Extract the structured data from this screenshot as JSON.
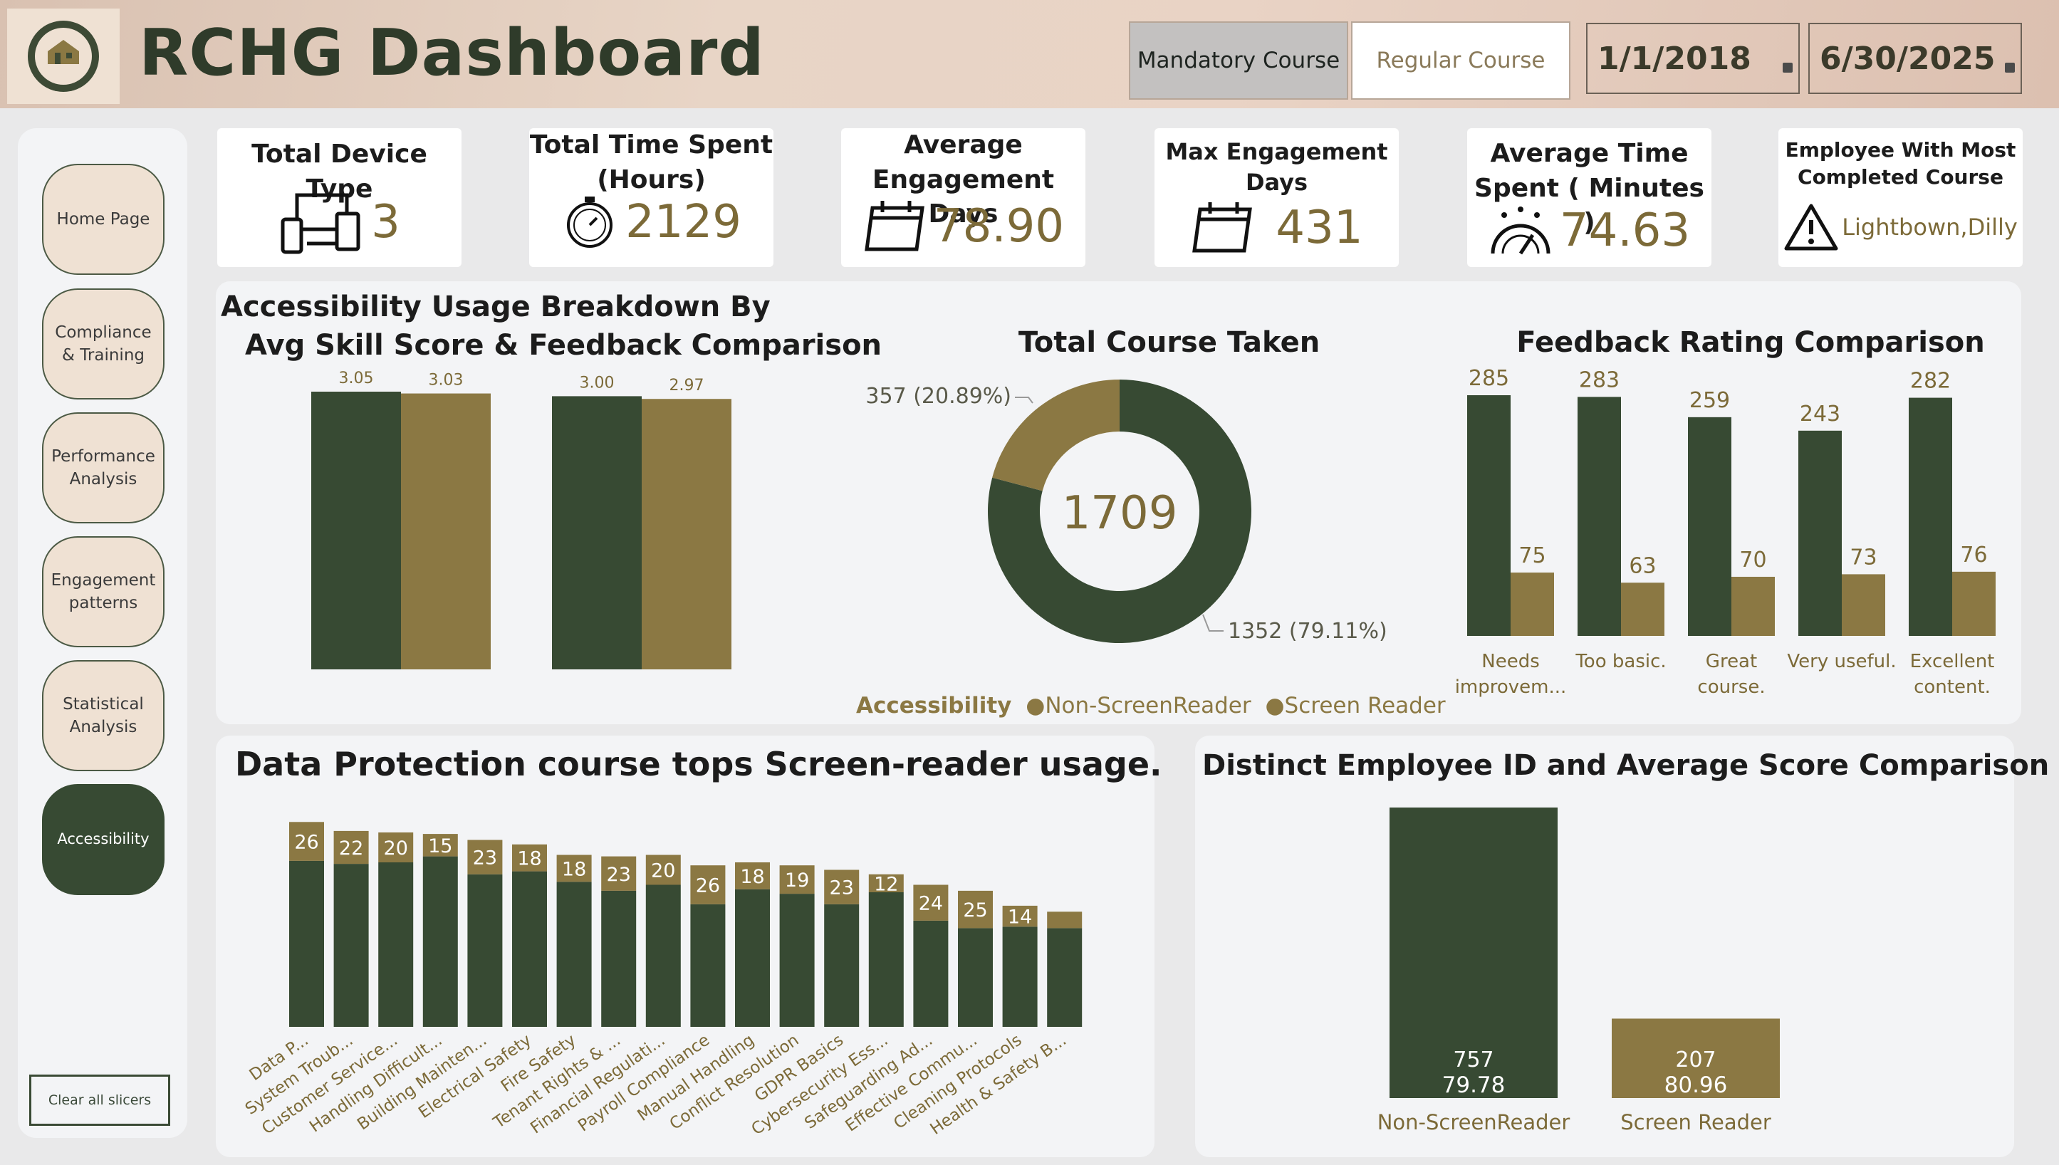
{
  "header": {
    "title": "RCHG Dashboard",
    "course_buttons": [
      "Mandatory Course",
      "Regular Course"
    ],
    "start_date": "1/1/2018",
    "end_date": "6/30/2025"
  },
  "sidebar": {
    "items": [
      "Home Page",
      "Compliance & Training",
      "Performance Analysis",
      "Engagement patterns",
      "Statistical Analysis",
      "Accessibility"
    ],
    "active": "Accessibility",
    "clear_label": "Clear all slicers"
  },
  "kpis": {
    "device": {
      "title": "Total Device Type",
      "value": "3",
      "icon": "devices-icon"
    },
    "time": {
      "title": "Total Time Spent (Hours)",
      "value": "2129",
      "icon": "stopwatch-icon"
    },
    "avg_eng": {
      "title": "Average Engagement Days",
      "value": "78.90",
      "icon": "calendar-icon"
    },
    "max_eng": {
      "title": "Max Engagement Days",
      "value": "431",
      "icon": "calendar-icon"
    },
    "avg_time": {
      "title": "Average Time Spent ( Minutes )",
      "value": "74.63",
      "icon": "speedometer-icon"
    },
    "top_emp": {
      "title": "Employee With Most Completed Course",
      "value": "Lightbown,Dilly",
      "icon": "warning-icon"
    }
  },
  "colors": {
    "dark": "#374a33",
    "gold": "#8b7843",
    "label": "#7c6a38"
  },
  "chart_data": [
    {
      "type": "bar",
      "title": "Accessibility Usage Breakdown By Avg Skill Score & Feedback Comparison",
      "categories": [
        "Avg Skill Score",
        "Feedback"
      ],
      "series": [
        {
          "name": "Non-ScreenReader",
          "values": [
            3.05,
            3.0
          ]
        },
        {
          "name": "Screen Reader",
          "values": [
            3.03,
            2.97
          ]
        }
      ],
      "ylim": [
        0,
        3.05
      ]
    },
    {
      "type": "pie",
      "title": "Total Course Taken",
      "total": "1709",
      "legend_title": "Accessibility",
      "slices": [
        {
          "name": "Non-ScreenReader",
          "value": 1352,
          "label": "1352 (79.11%)"
        },
        {
          "name": "Screen Reader",
          "value": 357,
          "label": "357 (20.89%)"
        }
      ]
    },
    {
      "type": "bar",
      "title": "Feedback Rating Comparison",
      "categories": [
        [
          "Needs",
          "improvem..."
        ],
        [
          "Too basic."
        ],
        [
          "Great",
          "course."
        ],
        [
          "Very useful."
        ],
        [
          "Excellent",
          "content."
        ]
      ],
      "series": [
        {
          "name": "Non-ScreenReader",
          "values": [
            285,
            283,
            259,
            243,
            282
          ]
        },
        {
          "name": "Screen Reader",
          "values": [
            75,
            63,
            70,
            73,
            76
          ]
        }
      ]
    },
    {
      "type": "bar",
      "title": "Data Protection course tops Screen-reader usage.",
      "categories": [
        "Data P...",
        "System Troub...",
        "Customer Service...",
        "Handling Difficult...",
        "Building Mainten...",
        "Electrical Safety",
        "Fire Safety",
        "Tenant Rights & ...",
        "Financial Regulati...",
        "Payroll Compliance",
        "Manual Handling",
        "Conflict Resolution",
        "GDPR Basics",
        "Cybersecurity Ess...",
        "Safeguarding Ad...",
        "Effective Commu...",
        "Cleaning Protocols",
        "Health & Safety B..."
      ],
      "series": [
        {
          "name": "Non-ScreenReader",
          "values": [
            111,
            109,
            110,
            114,
            102,
            104,
            97,
            91,
            95,
            82,
            92,
            89,
            82,
            90,
            71,
            66,
            67,
            66
          ]
        },
        {
          "name": "Screen Reader",
          "values": [
            26,
            22,
            20,
            15,
            23,
            18,
            18,
            23,
            20,
            26,
            18,
            19,
            23,
            12,
            24,
            25,
            14,
            11
          ]
        }
      ],
      "labels_shown": [
        26,
        22,
        20,
        15,
        23,
        18,
        18,
        23,
        20,
        26,
        18,
        19,
        23,
        12,
        24,
        25,
        14
      ]
    },
    {
      "type": "bar",
      "title": "Distinct Employee ID and Average Score Comparison",
      "categories": [
        "Non-ScreenReader",
        "Screen Reader"
      ],
      "values": [
        757,
        207
      ],
      "avg_score": [
        "79.78",
        "80.96"
      ],
      "count_labels": [
        "757",
        "207"
      ]
    }
  ]
}
